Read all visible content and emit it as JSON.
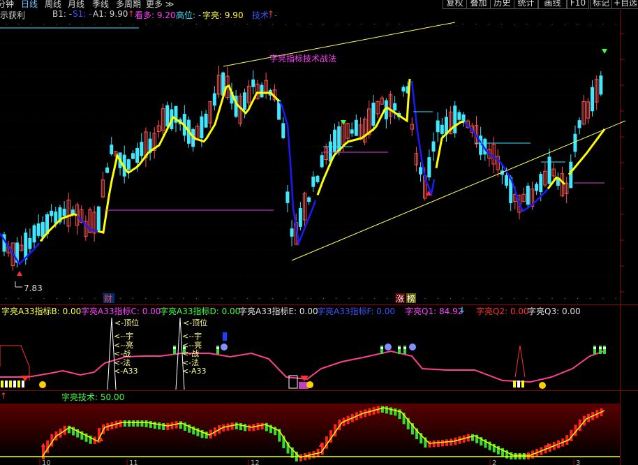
{
  "toolbar": {
    "period_items": [
      {
        "label": "分钟",
        "active": false
      },
      {
        "label": "日线",
        "active": true
      },
      {
        "label": "周线",
        "active": false
      },
      {
        "label": "月线",
        "active": false
      },
      {
        "label": "季线",
        "active": false
      },
      {
        "label": "多周期",
        "active": false
      },
      {
        "label": "更多",
        "active": false
      }
    ],
    "right_buttons": [
      "复权",
      "叠加",
      "历史",
      "统计",
      "画线",
      "F10",
      "标记",
      "+自选"
    ]
  },
  "main_info": {
    "indicator_name": "示获利",
    "items": [
      {
        "label": "B1: -",
        "color": "#d0d0d0"
      },
      {
        "label": "S1: -",
        "color": "#3a52ff"
      },
      {
        "label": "A1: 9.90",
        "color": "#d0d0d0"
      },
      {
        "label": "看多: 9.20",
        "color": "#ff40ff"
      },
      {
        "label": "高位: -",
        "color": "#40e0ff"
      },
      {
        "label": "字亮: 9.90",
        "color": "#ffff40"
      },
      {
        "label": "技术: -",
        "color": "#3a52ff"
      }
    ]
  },
  "chart_annotations": {
    "title_text": "字亮指标技术战法",
    "low_price_label": "7.83",
    "finance_marker": "财",
    "rise_marker": "涨",
    "rank_marker": "榜"
  },
  "panel2_info": {
    "items": [
      {
        "label": "字亮A33指标B: 0.00",
        "color": "#ffff40"
      },
      {
        "label": "字亮A33指标C: 0.00",
        "color": "#ff40ff"
      },
      {
        "label": "字亮A33指标D: 0.00",
        "color": "#40ff40"
      },
      {
        "label": "字亮A33指标E: 0.00",
        "color": "#e0e0e0"
      },
      {
        "label": "字亮A33指标F: 0.00",
        "color": "#3a52ff"
      },
      {
        "label": "字亮Q1: 84.92",
        "color": "#ff40ff"
      },
      {
        "label": "字亮Q2: 0.00",
        "color": "#ff3030"
      },
      {
        "label": "字亮Q3: 0.00",
        "color": "#e0e0e0"
      }
    ],
    "signal_labels": [
      "<-顶位",
      "<--宇",
      "<--亮",
      "<-战",
      "<-法",
      "<-A33"
    ]
  },
  "panel3_info": {
    "label": "字亮技术: 50.00"
  },
  "x_axis": {
    "month_labels": [
      "10",
      "11",
      "12",
      "2",
      "3"
    ]
  },
  "chart_data": {
    "type": "candlestick",
    "description_of_series": [
      "candles",
      "yellow-ma",
      "blue-ma"
    ],
    "low_label": 7.83
  },
  "colors": {
    "up": "#ff5050",
    "down": "#40e8ff",
    "ma_yellow": "#ffff00",
    "ma_blue": "#1a1aff",
    "magenta": "#ff40ff",
    "grid_red": "#7a0000"
  }
}
